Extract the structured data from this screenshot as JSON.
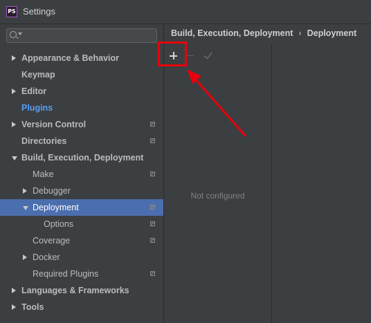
{
  "window": {
    "app_icon_text": "PS",
    "title": "Settings"
  },
  "search": {
    "value": "",
    "placeholder": ""
  },
  "tree": [
    {
      "label": "Appearance & Behavior",
      "level": 0,
      "arrow": "right",
      "bold": true,
      "copy": false
    },
    {
      "label": "Keymap",
      "level": 0,
      "arrow": "none",
      "bold": true,
      "copy": false
    },
    {
      "label": "Editor",
      "level": 0,
      "arrow": "right",
      "bold": true,
      "copy": false
    },
    {
      "label": "Plugins",
      "level": 0,
      "arrow": "none",
      "bold": true,
      "copy": false,
      "link": true
    },
    {
      "label": "Version Control",
      "level": 0,
      "arrow": "right",
      "bold": true,
      "copy": true
    },
    {
      "label": "Directories",
      "level": 0,
      "arrow": "none",
      "bold": true,
      "copy": true
    },
    {
      "label": "Build, Execution, Deployment",
      "level": 0,
      "arrow": "down",
      "bold": true,
      "copy": false
    },
    {
      "label": "Make",
      "level": 1,
      "arrow": "none",
      "bold": false,
      "copy": true
    },
    {
      "label": "Debugger",
      "level": 1,
      "arrow": "right",
      "bold": false,
      "copy": false
    },
    {
      "label": "Deployment",
      "level": 1,
      "arrow": "down",
      "bold": false,
      "copy": true,
      "selected": true
    },
    {
      "label": "Options",
      "level": 2,
      "arrow": "none",
      "bold": false,
      "copy": true
    },
    {
      "label": "Coverage",
      "level": 1,
      "arrow": "none",
      "bold": false,
      "copy": true
    },
    {
      "label": "Docker",
      "level": 1,
      "arrow": "right",
      "bold": false,
      "copy": false
    },
    {
      "label": "Required Plugins",
      "level": 1,
      "arrow": "none",
      "bold": false,
      "copy": true
    },
    {
      "label": "Languages & Frameworks",
      "level": 0,
      "arrow": "right",
      "bold": true,
      "copy": false
    },
    {
      "label": "Tools",
      "level": 0,
      "arrow": "right",
      "bold": true,
      "copy": false
    }
  ],
  "breadcrumb": {
    "parent": "Build, Execution, Deployment",
    "separator": "›",
    "current": "Deployment"
  },
  "deployment_panel": {
    "toolbar_icons": [
      "plus-icon",
      "minus-icon",
      "check-icon"
    ],
    "empty_text": "Not configured"
  },
  "annotation": {
    "color": "#e8000b"
  },
  "colors": {
    "selection": "#4b6eaf",
    "link": "#589df6"
  }
}
